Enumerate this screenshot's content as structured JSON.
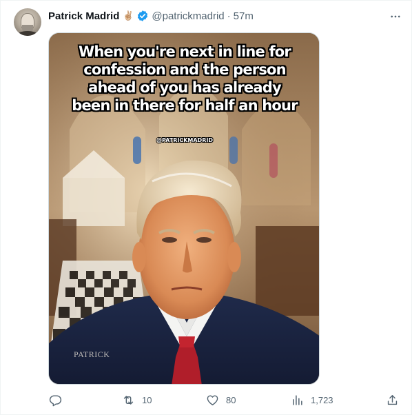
{
  "tweet": {
    "author_name": "Patrick Madrid",
    "author_emoji": "✌🏼",
    "handle": "@patrickmadrid",
    "separator": "·",
    "time": "57m"
  },
  "media": {
    "caption_lines": [
      "When you're next in line for",
      "confession and the person",
      "ahead of you has already",
      "been in there for half an hour"
    ],
    "watermark": "@PATRICKMADRID",
    "signature": "PATRICK"
  },
  "actions": {
    "replies": "",
    "retweets": "10",
    "likes": "80",
    "views": "1,723"
  },
  "icons": {
    "more": "more-horizontal-icon",
    "verified": "verified-badge-icon",
    "reply": "reply-icon",
    "retweet": "retweet-icon",
    "like": "heart-icon",
    "views": "views-chart-icon",
    "share": "share-icon"
  },
  "colors": {
    "verified": "#1d9bf0",
    "secondary_text": "#536471",
    "primary_text": "#0f1419"
  }
}
